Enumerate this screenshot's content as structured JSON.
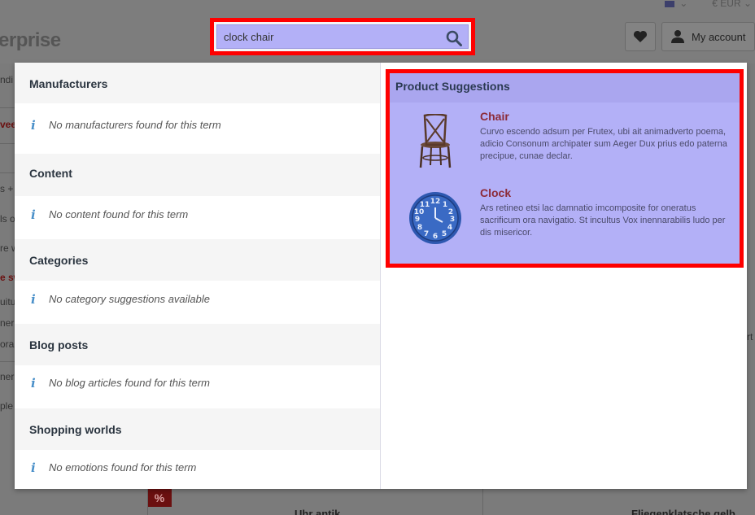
{
  "topbar": {
    "language": "",
    "currency": "€ EUR"
  },
  "shop_logo": "erprise",
  "search": {
    "value": "clock chair"
  },
  "header": {
    "account_label": "My account"
  },
  "background": {
    "left_texts": [
      "ndi",
      "vee",
      "s +",
      "ls o",
      "re w",
      "e sw",
      "uitu",
      "ner",
      "ora",
      "ner",
      "ple"
    ],
    "right_texts": [
      "rt"
    ],
    "badge": "%",
    "card_titles": [
      "Uhr antik",
      "Fliegenklatsche gelb"
    ]
  },
  "dropdown": {
    "sections": [
      {
        "title": "Manufacturers",
        "message": "No manufacturers found for this term"
      },
      {
        "title": "Content",
        "message": "No content found for this term"
      },
      {
        "title": "Categories",
        "message": "No category suggestions available"
      },
      {
        "title": "Blog posts",
        "message": "No blog articles found for this term"
      },
      {
        "title": "Shopping worlds",
        "message": "No emotions found for this term"
      }
    ],
    "product_suggestions": {
      "title": "Product Suggestions",
      "products": [
        {
          "name": "Chair",
          "description": "Curvo escendo adsum per Frutex, ubi ait animadverto poema, adicio Consonum archipater sum Aeger Dux prius edo paterna precipue, cunae declar."
        },
        {
          "name": "Clock",
          "description": "Ars retineo etsi lac damnatio imcomposite for oneratus sacrificum ora navigatio. St incultus Vox inennarabilis ludo per dis misericor."
        }
      ]
    }
  },
  "colors": {
    "highlight": "#ff0000",
    "overlay": "#b3b0f7",
    "product_name": "#8c2b38",
    "info_icon": "#4a90c9"
  },
  "icons": {
    "search": "magnifier-icon",
    "wishlist": "heart-icon",
    "account": "person-icon",
    "info": "info-icon"
  }
}
